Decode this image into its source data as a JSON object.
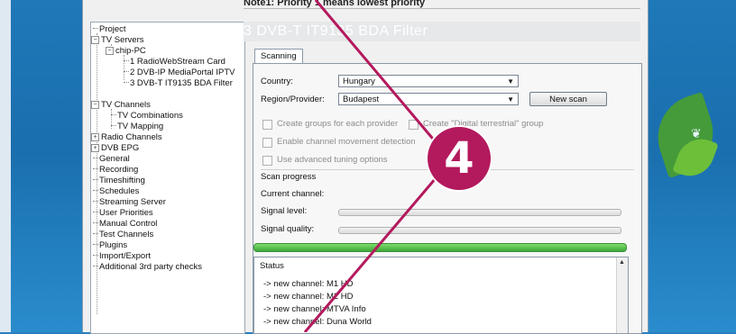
{
  "note_top": "Note1: Priority 1 means lowest priority",
  "tree": {
    "items": [
      {
        "label": "Project"
      },
      {
        "label": "TV Servers",
        "toggle": "−"
      },
      {
        "label": "chip-PC",
        "toggle": "−"
      },
      {
        "label": "1 RadioWebStream Card"
      },
      {
        "label": "2 DVB-IP MediaPortal IPTV"
      },
      {
        "label": "3 DVB-T IT9135 BDA Filter"
      },
      {
        "label": "TV Channels",
        "toggle": "−"
      },
      {
        "label": "TV Combinations"
      },
      {
        "label": "TV Mapping"
      },
      {
        "label": "Radio Channels",
        "toggle": "+"
      },
      {
        "label": "DVB EPG",
        "toggle": "+"
      },
      {
        "label": "General"
      },
      {
        "label": "Recording"
      },
      {
        "label": "Timeshifting"
      },
      {
        "label": "Schedules"
      },
      {
        "label": "Streaming Server"
      },
      {
        "label": "User Priorities"
      },
      {
        "label": "Manual Control"
      },
      {
        "label": "Test Channels"
      },
      {
        "label": "Plugins"
      },
      {
        "label": "Import/Export"
      },
      {
        "label": "Additional 3rd party checks"
      }
    ]
  },
  "main": {
    "title": "3 DVB-T IT9135 BDA Filter",
    "tab_scanning": "Scanning",
    "country_label": "Country:",
    "country_value": "Hungary",
    "region_label": "Region/Provider:",
    "region_value": "Budapest",
    "new_scan_label": "New scan",
    "create_groups_label": "Create groups for each provider",
    "create_digital_label": "Create \"Digital terrestrial\" group",
    "enable_movement_label": "Enable channel movement detection",
    "advanced_tuning_label": "Use advanced tuning options",
    "scan_progress_label": "Scan progress",
    "current_channel_label": "Current channel:",
    "signal_level_label": "Signal level:",
    "signal_quality_label": "Signal quality:",
    "scan_progress_value": 1.0
  },
  "status": {
    "header": "Status",
    "lines": [
      "-> new channel: M1 HD",
      "-> new channel: M2 HD",
      "-> new channel: MTVA Info",
      "-> new channel: Duna World"
    ]
  },
  "badge": "4",
  "colors": {
    "accent_badge": "#b3195d",
    "progress": "#3ca93a"
  }
}
